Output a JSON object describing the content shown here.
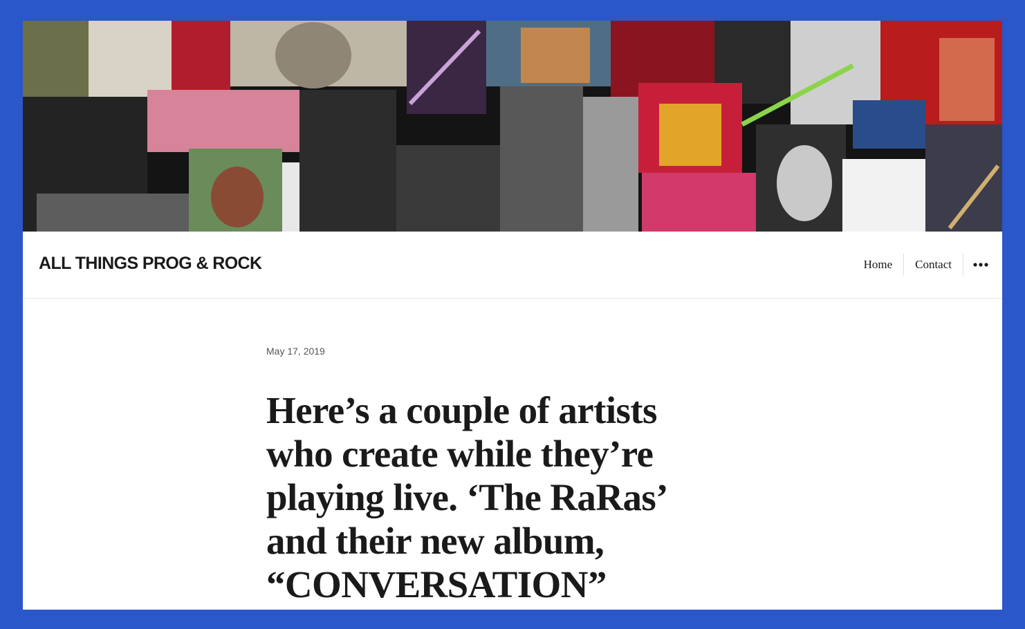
{
  "header": {
    "banner_alt": "Collage of rock musicians",
    "site_title": "ALL THINGS PROG & ROCK"
  },
  "nav": {
    "items": [
      {
        "label": "Home"
      },
      {
        "label": "Contact"
      }
    ],
    "more_icon": "ellipsis-icon"
  },
  "post": {
    "date": "May 17, 2019",
    "title": "Here’s a couple of artists who create while they’re playing live. ‘The RaRas’ and their new album, “CONVERSATION”"
  },
  "colors": {
    "page_border": "#2a57c9",
    "background": "#ffffff",
    "text": "#1a1a1a",
    "meta": "#555555"
  }
}
